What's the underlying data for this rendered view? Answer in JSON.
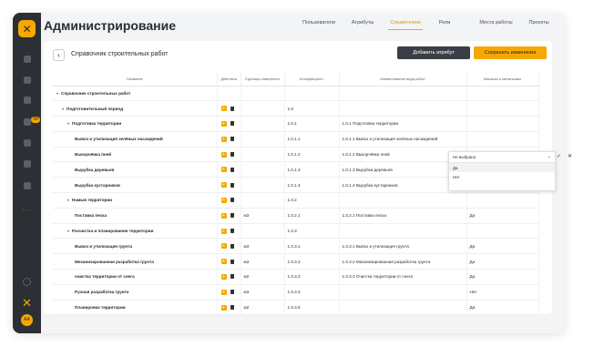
{
  "header": {
    "title": "Администрирование"
  },
  "tabs": [
    "Пользователи",
    "Атрибуты",
    "Справочники",
    "Роли",
    "Места работы",
    "Проекты"
  ],
  "active_tab": 2,
  "sidebar": {
    "badge": "99",
    "avatar": "AA"
  },
  "card": {
    "back": "‹",
    "title": "Справочник строительных работ",
    "add_button": "Добавить атрибут",
    "save_button": "Сохранить изменения"
  },
  "columns": [
    "Название",
    "Действия",
    "Единица измерения",
    "Коэффициент",
    "Наименование вида работ",
    "Машины и механизмы"
  ],
  "rows": [
    {
      "level": 0,
      "name": "Справочник строительных работ",
      "actions": false,
      "unit": "",
      "code": "",
      "work": "",
      "mach": ""
    },
    {
      "level": 1,
      "name": "Подготовительный период",
      "actions": true,
      "trash": true,
      "unit": "",
      "code": "1.0",
      "work": "",
      "mach": ""
    },
    {
      "level": 2,
      "name": "Подготовка территории",
      "actions": true,
      "trash": true,
      "unit": "",
      "code": "1.0.1",
      "work": "1.0.1 Подготовка территории",
      "mach": ""
    },
    {
      "level": 3,
      "name": "Вывоз и утилизация зелёных насаждений",
      "actions": true,
      "trash": true,
      "unit": "",
      "code": "1.0.1.1",
      "work": "1.0.1.1 Вывоз и утилизация зелёных насаждений",
      "mach": ""
    },
    {
      "level": 3,
      "name": "Выкорчёвка пней",
      "actions": true,
      "trash": true,
      "unit": "",
      "code": "1.0.1.2",
      "work": "1.0.1.2 Выкорчёвка пней",
      "mach": ""
    },
    {
      "level": 3,
      "name": "Вырубка деревьев",
      "actions": true,
      "trash": true,
      "unit": "",
      "code": "1.0.1.3",
      "work": "1.0.1.3 Вырубка деревьев",
      "mach": ""
    },
    {
      "level": 3,
      "name": "Вырубка кустарников",
      "actions": true,
      "trash": true,
      "unit": "",
      "code": "1.0.1.4",
      "work": "1.0.1.4 Вырубка кустарников",
      "mach": ""
    },
    {
      "level": 2,
      "name": "Намыв территории",
      "actions": true,
      "trash": true,
      "unit": "",
      "code": "1.0.2",
      "work": "",
      "mach": ""
    },
    {
      "level": 3,
      "name": "Поставка песка",
      "actions": true,
      "trash": true,
      "unit": "м3",
      "code": "1.0.2.1",
      "work": "1.0.2.1 Поставка песка",
      "mach": "Да"
    },
    {
      "level": 2,
      "name": "Расчистка и планирование территории",
      "actions": true,
      "trash": true,
      "unit": "",
      "code": "1.0.3",
      "work": "",
      "mach": ""
    },
    {
      "level": 3,
      "name": "Вывоз и утилизация грунта",
      "actions": true,
      "trash": true,
      "unit": "м3",
      "code": "1.0.3.1",
      "work": "1.0.3.1 Вывоз и утилизация грунта",
      "mach": "Да"
    },
    {
      "level": 3,
      "name": "Механизированная разработка грунта",
      "actions": true,
      "trash": true,
      "unit": "м3",
      "code": "1.0.3.2",
      "work": "1.0.3.2 Механизированная разработка грунта",
      "mach": "Да"
    },
    {
      "level": 3,
      "name": "очистка территории от снега",
      "actions": true,
      "trash": true,
      "unit": "м2",
      "code": "1.0.3.3",
      "work": "1.0.3.3 Очистка территории от снега",
      "mach": "Да"
    },
    {
      "level": 3,
      "name": "Ручная разработка грунта",
      "actions": true,
      "trash": true,
      "unit": "м3",
      "code": "1.0.3.4",
      "work": "",
      "mach": "Нет"
    },
    {
      "level": 3,
      "name": "Планировка территории",
      "actions": true,
      "trash": true,
      "unit": "м2",
      "code": "1.0.3.5",
      "work": "",
      "mach": "Да"
    }
  ],
  "dropdown": {
    "selected": "Не выбрано",
    "options": [
      "Да",
      "Нет"
    ],
    "confirm": "✓",
    "cancel": "✕"
  },
  "colors": {
    "accent": "#f6a800",
    "sidebar": "#2c2f33",
    "dark_button": "#3b3e45"
  }
}
